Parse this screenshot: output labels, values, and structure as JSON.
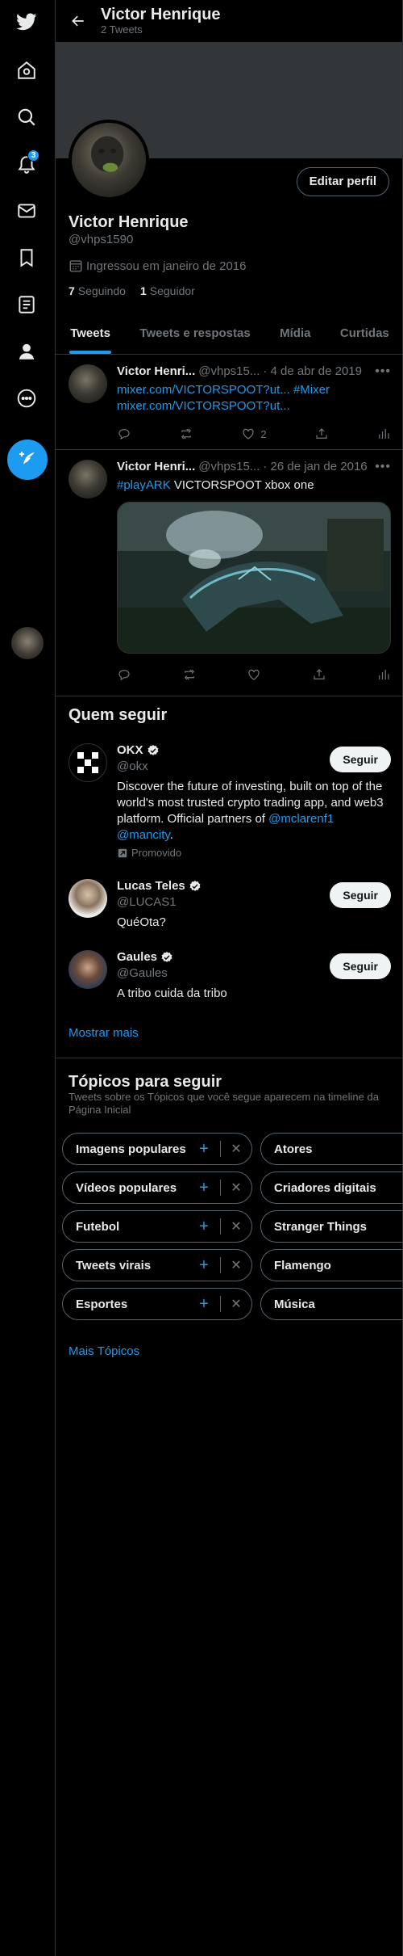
{
  "sidebar": {
    "items": [
      {
        "name": "twitter-logo-icon",
        "label": "Twitter"
      },
      {
        "name": "home-icon",
        "label": "Página Inicial"
      },
      {
        "name": "search-icon",
        "label": "Explorar"
      },
      {
        "name": "bell-icon",
        "label": "Notificações",
        "badge": "3"
      },
      {
        "name": "mail-icon",
        "label": "Mensagens"
      },
      {
        "name": "bookmark-icon",
        "label": "Itens salvos"
      },
      {
        "name": "list-icon",
        "label": "Listas"
      },
      {
        "name": "profile-icon",
        "label": "Perfil"
      },
      {
        "name": "more-icon",
        "label": "Mais"
      }
    ],
    "notification_badge": "3"
  },
  "header": {
    "title": "Victor Henrique",
    "subtitle": "2 Tweets"
  },
  "profile": {
    "name": "Victor Henrique",
    "handle": "@vhps1590",
    "joined": "Ingressou em janeiro de 2016",
    "following_count": "7",
    "following_label": "Seguindo",
    "followers_count": "1",
    "followers_label": "Seguidor",
    "edit_label": "Editar perfil"
  },
  "tabs": [
    "Tweets",
    "Tweets e respostas",
    "Mídia",
    "Curtidas"
  ],
  "tweets": [
    {
      "name": "Victor Henri...",
      "handle": "@vhps15...",
      "date": "· 4 de abr de 2019",
      "line1_link": "mixer.com/VICTORSPOOT?ut...",
      "line1_tag": "#Mixer",
      "line2_link": "mixer.com/VICTORSPOOT?ut...",
      "likes": "2"
    },
    {
      "name": "Victor Henri...",
      "handle": "@vhps15...",
      "date": "· 26 de jan de 2016",
      "tag": "#playARK",
      "text": " VICTORSPOOT xbox one"
    }
  ],
  "who_to_follow": {
    "title": "Quem seguir",
    "show_more": "Mostrar mais",
    "follow_label": "Seguir",
    "accounts": [
      {
        "name": "OKX",
        "handle": "@okx",
        "bio_text": "Discover the future of investing, built on top of the world's most trusted crypto trading app, and web3 platform. Official partners of ",
        "bio_link1": "@mclarenf1",
        "bio_link2": "@mancity",
        "promoted": "Promovido"
      },
      {
        "name": "Lucas Teles",
        "handle": "@LUCAS1",
        "bio": "QuéOta?"
      },
      {
        "name": "Gaules",
        "handle": "@Gaules",
        "bio": "A tribo cuida da tribo"
      }
    ]
  },
  "topics": {
    "title": "Tópicos para seguir",
    "subtitle": "Tweets sobre os Tópicos que você segue aparecem na timeline da Página Inicial",
    "left": [
      "Imagens populares",
      "Vídeos populares",
      "Futebol",
      "Tweets virais",
      "Esportes"
    ],
    "right": [
      "Atores",
      "Criadores digitais",
      "Stranger Things",
      "Flamengo",
      "Música"
    ],
    "more": "Mais Tópicos"
  },
  "colors": {
    "accent": "#1d9bf0",
    "background": "#000000",
    "text_secondary": "#71767b",
    "border": "#2f3336"
  }
}
